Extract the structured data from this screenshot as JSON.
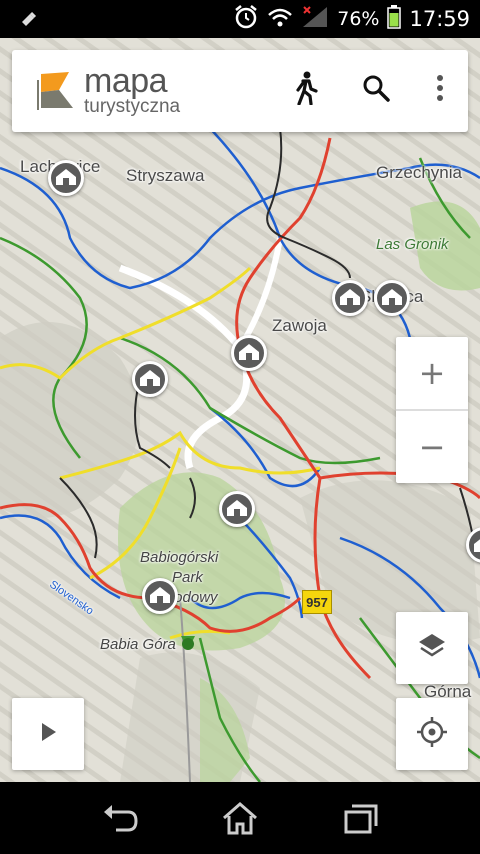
{
  "status_bar": {
    "battery_percent": "76%",
    "time": "17:59",
    "icons": [
      "notification-icon",
      "alarm-clock-icon",
      "wifi-icon",
      "signal-icon",
      "battery-icon"
    ]
  },
  "app": {
    "logo_title": "mapa",
    "logo_subtitle": "turystyczna",
    "actions": [
      "hiking-mode-icon",
      "search-icon",
      "more-vert-icon"
    ]
  },
  "map": {
    "places": {
      "lachowice": "Lachowice",
      "stryszawa": "Stryszawa",
      "grzechynia": "Grzechynia",
      "las_gronik": "Las Gronik",
      "skawica": "Skawica",
      "zawoja": "Zawoja",
      "park_line1": "Babiogórski",
      "park_line2": "Park",
      "park_line3": "Narodowy",
      "babia_gora": "Babia Góra",
      "slovensko": "Slovensko",
      "gorna": "Górna"
    },
    "road_number": "957",
    "colors": {
      "red_trail": "#e0412f",
      "blue_trail": "#1f5fd0",
      "green_trail": "#3d9a2f",
      "yellow_trail": "#f0de2a",
      "black_trail": "#2b2b2b",
      "forest": "#b8d49a"
    }
  },
  "controls": {
    "zoom_in": "+",
    "zoom_out": "−",
    "layers": "layers-icon",
    "locate": "my-location-icon",
    "play": "play-icon"
  },
  "nav_bar": {
    "icons": [
      "back-icon",
      "home-icon",
      "recents-icon"
    ]
  }
}
